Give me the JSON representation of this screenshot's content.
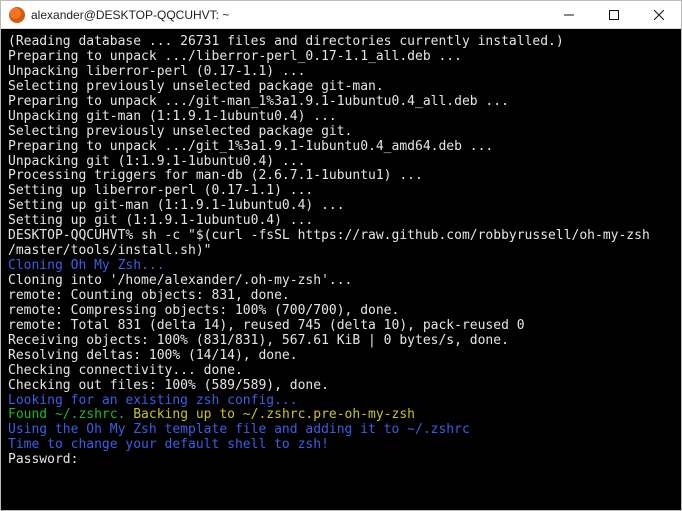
{
  "window": {
    "title": "alexander@DESKTOP-QQCUHVT: ~"
  },
  "lines": [
    {
      "cls": "white",
      "t": "(Reading database ... 26731 files and directories currently installed.)"
    },
    {
      "cls": "white",
      "t": "Preparing to unpack .../liberror-perl_0.17-1.1_all.deb ..."
    },
    {
      "cls": "white",
      "t": "Unpacking liberror-perl (0.17-1.1) ..."
    },
    {
      "cls": "white",
      "t": "Selecting previously unselected package git-man."
    },
    {
      "cls": "white",
      "t": "Preparing to unpack .../git-man_1%3a1.9.1-1ubuntu0.4_all.deb ..."
    },
    {
      "cls": "white",
      "t": "Unpacking git-man (1:1.9.1-1ubuntu0.4) ..."
    },
    {
      "cls": "white",
      "t": "Selecting previously unselected package git."
    },
    {
      "cls": "white",
      "t": "Preparing to unpack .../git_1%3a1.9.1-1ubuntu0.4_amd64.deb ..."
    },
    {
      "cls": "white",
      "t": "Unpacking git (1:1.9.1-1ubuntu0.4) ..."
    },
    {
      "cls": "white",
      "t": "Processing triggers for man-db (2.6.7.1-1ubuntu1) ..."
    },
    {
      "cls": "white",
      "t": "Setting up liberror-perl (0.17-1.1) ..."
    },
    {
      "cls": "white",
      "t": "Setting up git-man (1:1.9.1-1ubuntu0.4) ..."
    },
    {
      "cls": "white",
      "t": "Setting up git (1:1.9.1-1ubuntu0.4) ..."
    },
    {
      "cls": "white",
      "t": "DESKTOP-QQCUHVT% sh -c \"$(curl -fsSL https://raw.github.com/robbyrussell/oh-my-zsh"
    },
    {
      "cls": "white",
      "t": "/master/tools/install.sh)\""
    },
    {
      "cls": "blue",
      "t": "Cloning Oh My Zsh..."
    },
    {
      "cls": "white",
      "t": "Cloning into '/home/alexander/.oh-my-zsh'..."
    },
    {
      "cls": "white",
      "t": "remote: Counting objects: 831, done."
    },
    {
      "cls": "white",
      "t": "remote: Compressing objects: 100% (700/700), done."
    },
    {
      "cls": "white",
      "t": "remote: Total 831 (delta 14), reused 745 (delta 10), pack-reused 0"
    },
    {
      "cls": "white",
      "t": "Receiving objects: 100% (831/831), 567.61 KiB | 0 bytes/s, done."
    },
    {
      "cls": "white",
      "t": "Resolving deltas: 100% (14/14), done."
    },
    {
      "cls": "white",
      "t": "Checking connectivity... done."
    },
    {
      "cls": "white",
      "t": "Checking out files: 100% (589/589), done."
    },
    {
      "cls": "blue",
      "t": "Looking for an existing zsh config..."
    }
  ],
  "mixed_line": {
    "green": "Found ~/.zshrc. ",
    "yellow": "Backing up to ~/.zshrc.pre-oh-my-zsh"
  },
  "tail": [
    {
      "cls": "blue",
      "t": "Using the Oh My Zsh template file and adding it to ~/.zshrc"
    },
    {
      "cls": "blue",
      "t": "Time to change your default shell to zsh!"
    },
    {
      "cls": "white",
      "t": "Password:"
    }
  ]
}
